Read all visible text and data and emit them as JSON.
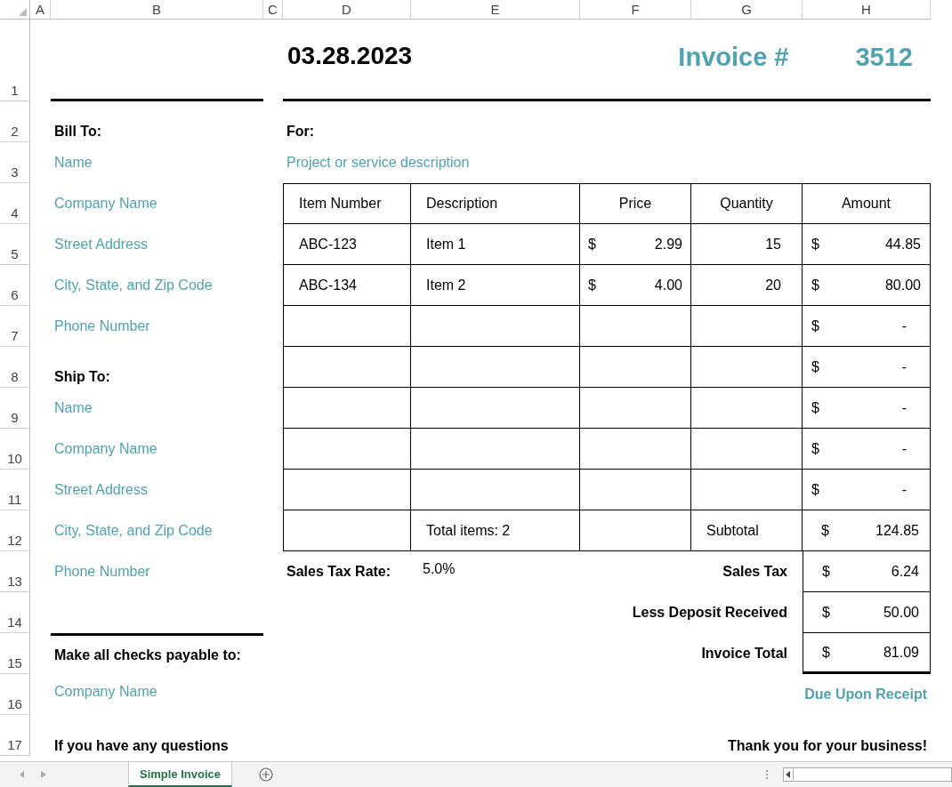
{
  "column_headers": [
    "A",
    "B",
    "C",
    "D",
    "E",
    "F",
    "G",
    "H"
  ],
  "row_headers": [
    "1",
    "2",
    "3",
    "4",
    "5",
    "6",
    "7",
    "8",
    "9",
    "10",
    "11",
    "12",
    "13",
    "14",
    "15",
    "16",
    "17"
  ],
  "date": "03.28.2023",
  "invoice_label": "Invoice #",
  "invoice_number": "3512",
  "bill_to": {
    "heading": "Bill To:",
    "lines": [
      "Name",
      "Company Name",
      "Street Address",
      "City, State, and Zip Code",
      "Phone Number"
    ]
  },
  "ship_to": {
    "heading": "Ship To:",
    "lines": [
      "Name",
      "Company Name",
      "Street Address",
      "City, State, and Zip Code",
      "Phone Number"
    ]
  },
  "for": {
    "heading": "For:",
    "description": "Project or service description"
  },
  "table": {
    "columns": [
      "Item Number",
      "Description",
      "Price",
      "Quantity",
      "Amount"
    ],
    "rows": [
      {
        "item_number": "ABC-123",
        "description": "Item 1",
        "price_currency": "$",
        "price": "2.99",
        "quantity": "15",
        "amount_currency": "$",
        "amount": "44.85"
      },
      {
        "item_number": "ABC-134",
        "description": "Item 2",
        "price_currency": "$",
        "price": "4.00",
        "quantity": "20",
        "amount_currency": "$",
        "amount": "80.00"
      },
      {
        "amount_currency": "$",
        "amount": "-"
      },
      {
        "amount_currency": "$",
        "amount": "-"
      },
      {
        "amount_currency": "$",
        "amount": "-"
      },
      {
        "amount_currency": "$",
        "amount": "-"
      },
      {
        "amount_currency": "$",
        "amount": "-"
      }
    ],
    "total_items": "Total items: 2",
    "subtotal_label": "Subtotal",
    "subtotal_currency": "$",
    "subtotal": "124.85"
  },
  "tax_rate_label": "Sales Tax Rate:",
  "tax_rate": "5.0%",
  "summary": [
    {
      "label": "Sales Tax",
      "currency": "$",
      "value": "6.24"
    },
    {
      "label": "Less Deposit Received",
      "currency": "$",
      "value": "50.00"
    },
    {
      "label": "Invoice Total",
      "currency": "$",
      "value": "81.09"
    }
  ],
  "due": "Due Upon Receipt",
  "checks": {
    "heading": "Make all checks payable to:",
    "company": "Company Name"
  },
  "questions": "If you have any questions",
  "thanks": "Thank you for your business!",
  "sheet_tabs": [
    {
      "label": "Simple Invoice",
      "selected": true
    }
  ]
}
